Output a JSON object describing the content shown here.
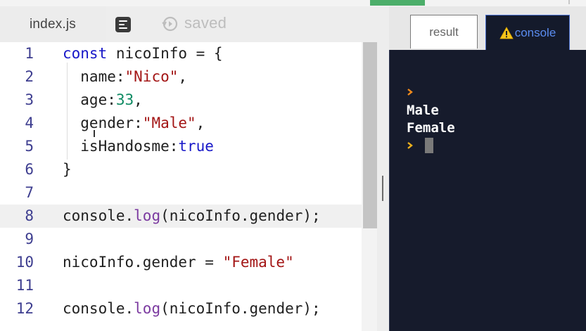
{
  "editor": {
    "file_tab_label": "index.js",
    "saved_label": "saved",
    "lines": [
      {
        "number": "1",
        "tokens": [
          {
            "t": "const",
            "c": "kw"
          },
          {
            "t": " nicoInfo = {",
            "c": ""
          }
        ]
      },
      {
        "number": "2",
        "tokens": [
          {
            "t": "  name:",
            "c": ""
          },
          {
            "t": "\"Nico\"",
            "c": "str"
          },
          {
            "t": ",",
            "c": ""
          }
        ]
      },
      {
        "number": "3",
        "tokens": [
          {
            "t": "  age:",
            "c": ""
          },
          {
            "t": "33",
            "c": "num"
          },
          {
            "t": ",",
            "c": ""
          }
        ]
      },
      {
        "number": "4",
        "tokens": [
          {
            "t": "  gender:",
            "c": ""
          },
          {
            "t": "\"Male\"",
            "c": "str"
          },
          {
            "t": ",",
            "c": ""
          }
        ]
      },
      {
        "number": "5",
        "tokens": [
          {
            "t": "  isHandosme:",
            "c": ""
          },
          {
            "t": "true",
            "c": "bool"
          }
        ]
      },
      {
        "number": "6",
        "tokens": [
          {
            "t": "}",
            "c": ""
          }
        ]
      },
      {
        "number": "7",
        "tokens": []
      },
      {
        "number": "8",
        "tokens": [
          {
            "t": "console.",
            "c": ""
          },
          {
            "t": "log",
            "c": "fn"
          },
          {
            "t": "(nicoInfo.gender);",
            "c": ""
          }
        ]
      },
      {
        "number": "9",
        "tokens": []
      },
      {
        "number": "10",
        "tokens": [
          {
            "t": "nicoInfo.gender = ",
            "c": ""
          },
          {
            "t": "\"Female\"",
            "c": "str"
          }
        ]
      },
      {
        "number": "11",
        "tokens": []
      },
      {
        "number": "12",
        "tokens": [
          {
            "t": "console.",
            "c": ""
          },
          {
            "t": "log",
            "c": "fn"
          },
          {
            "t": "(nicoInfo.gender);",
            "c": ""
          }
        ]
      }
    ],
    "active_line": "8"
  },
  "preview": {
    "tabs": [
      {
        "label": "result",
        "active": false
      },
      {
        "label": "console",
        "active": true,
        "icon": "warning-icon"
      }
    ],
    "console_output": [
      "Male",
      "Female"
    ]
  },
  "colors": {
    "keyword": "#1717c8",
    "string": "#a31515",
    "number": "#0e8a62",
    "function": "#7b3aa0",
    "console_bg": "#161b2c",
    "accent_green": "#4cae6a"
  }
}
